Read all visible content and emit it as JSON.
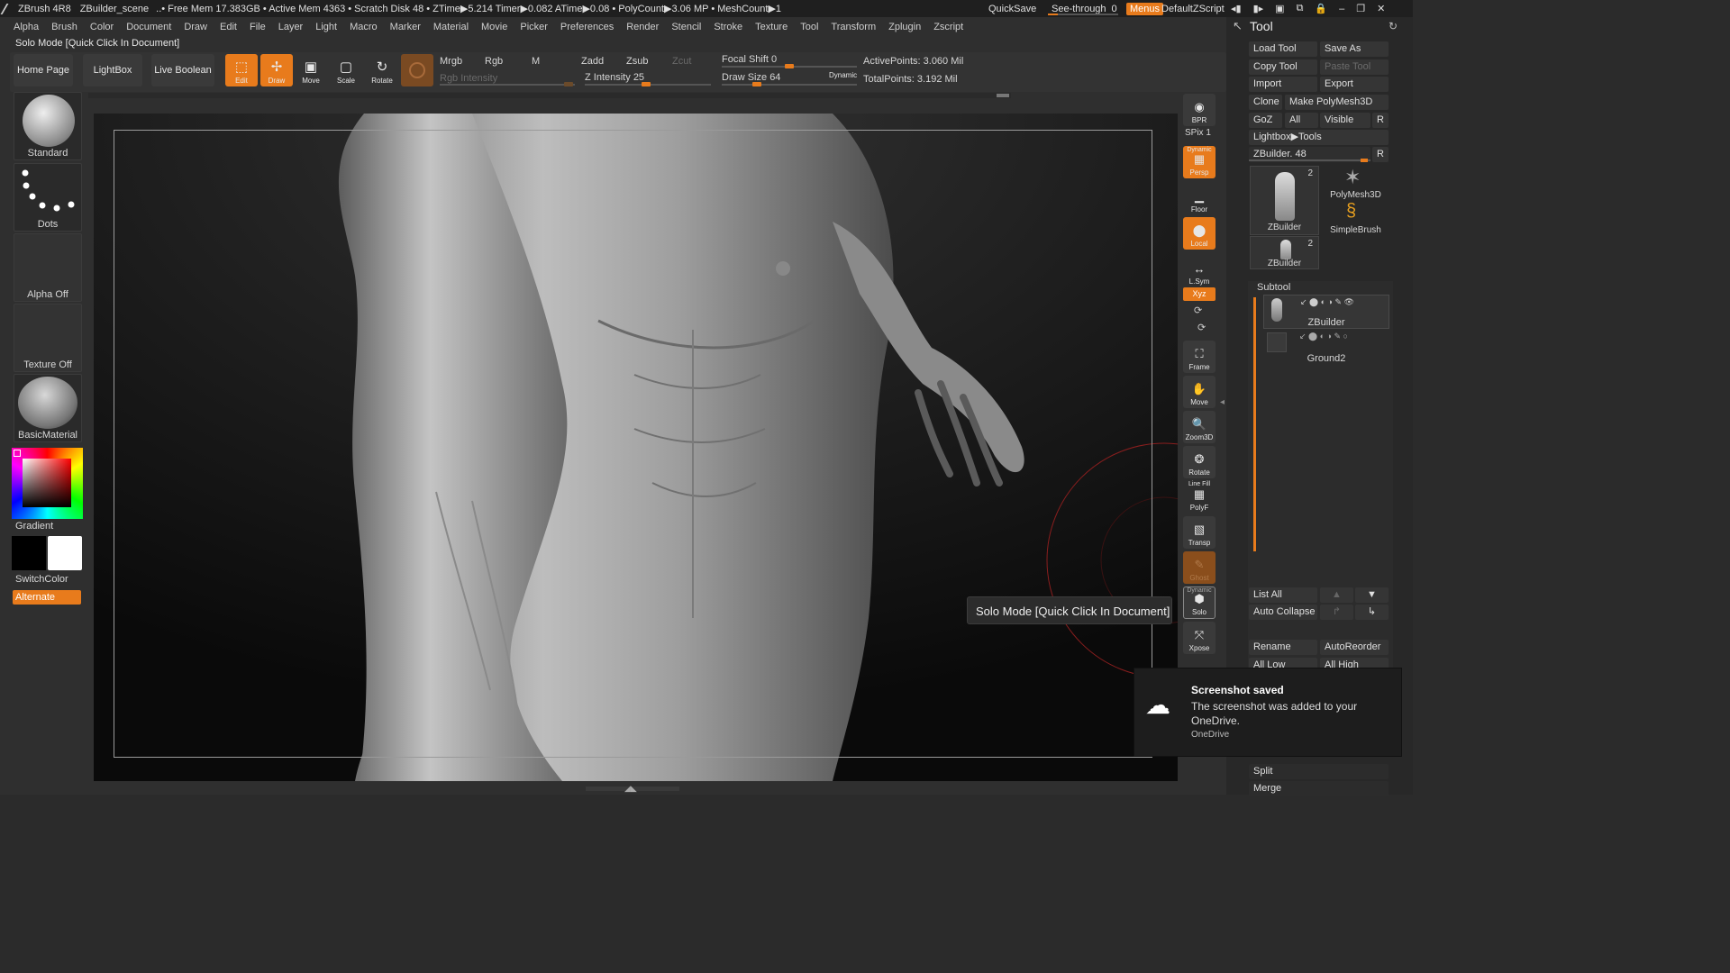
{
  "titlebar": {
    "app": "ZBrush 4R8",
    "scene": "ZBuilder_scene",
    "stats": "..• Free Mem 17.383GB • Active Mem 4363 • Scratch Disk 48 • ZTime▶5.214 Timer▶0.082 ATime▶0.08 • PolyCount▶3.06 MP • MeshCount▶1",
    "quicksave": "QuickSave",
    "seethrough_label": "See-through",
    "seethrough_value": "0",
    "seethrough_level": 0.0,
    "menus": "Menus",
    "script": "DefaultZScript"
  },
  "menubar": [
    "Alpha",
    "Brush",
    "Color",
    "Document",
    "Draw",
    "Edit",
    "File",
    "Layer",
    "Light",
    "Macro",
    "Marker",
    "Material",
    "Movie",
    "Picker",
    "Preferences",
    "Render",
    "Stencil",
    "Stroke",
    "Texture",
    "Tool",
    "Transform",
    "Zplugin",
    "Zscript"
  ],
  "solo_status": "Solo Mode [Quick Click In Document]",
  "toolbar": {
    "home": "Home Page",
    "lightbox": "LightBox",
    "live_boolean": "Live Boolean",
    "edit": "Edit",
    "draw": "Draw",
    "move": "Move",
    "scale": "Scale",
    "rotate": "Rotate",
    "mrgb": "Mrgb",
    "rgb": "Rgb",
    "m": "M",
    "rgb_intensity": "Rgb Intensity",
    "zadd": "Zadd",
    "zsub": "Zsub",
    "zcut": "Zcut",
    "z_intensity_label": "Z Intensity",
    "z_intensity": "25",
    "focal_shift_label": "Focal Shift",
    "focal_shift": "0",
    "draw_size_label": "Draw Size",
    "draw_size": "64",
    "dynamic": "Dynamic",
    "active_points": "ActivePoints: 3.060 Mil",
    "total_points": "TotalPoints: 3.192 Mil"
  },
  "left_shelf": {
    "brush": "Standard",
    "stroke": "Dots",
    "alpha": "Alpha Off",
    "texture": "Texture Off",
    "material": "BasicMaterial",
    "gradient": "Gradient",
    "switchcolor": "SwitchColor",
    "alternate": "Alternate",
    "colors": {
      "accent": "#e87b1c",
      "primary": "#000000",
      "secondary": "#ffffff"
    }
  },
  "right_shelf": {
    "bpr": "BPR",
    "spix": "SPix 1",
    "persp": "Persp",
    "dynamic": "Dynamic",
    "floor": "Floor",
    "local": "Local",
    "lsym": "L.Sym",
    "xyz": "Xyz",
    "frame": "Frame",
    "move": "Move",
    "zoom3d": "Zoom3D",
    "rotate": "Rotate",
    "line_fill": "Line Fill",
    "polyf": "PolyF",
    "transp": "Transp",
    "ghost": "Ghost",
    "solo": "Solo",
    "solo_dynamic": "Dynamic",
    "xpose": "Xpose"
  },
  "tooltip": "Solo Mode [Quick Click In Document]",
  "tool_panel": {
    "title": "Tool",
    "load_tool": "Load Tool",
    "save_as": "Save As",
    "copy_tool": "Copy Tool",
    "paste_tool": "Paste Tool",
    "import": "Import",
    "export": "Export",
    "clone": "Clone",
    "make_polymesh": "Make PolyMesh3D",
    "goz": "GoZ",
    "all": "All",
    "visible": "Visible",
    "r": "R",
    "lightbox_tools": "Lightbox▶Tools",
    "zbuilder_slider": "ZBuilder. 48",
    "thumb_zbuilder": "ZBuilder",
    "thumb_count": "2",
    "thumb_polymesh": "PolyMesh3D",
    "thumb_simplebrush": "SimpleBrush",
    "thumb_zbuilder2": "ZBuilder",
    "thumb_count2": "2",
    "subtool": "Subtool",
    "subtool_items": [
      "ZBuilder",
      "Ground2"
    ],
    "list_all": "List All",
    "auto_collapse": "Auto Collapse",
    "rename": "Rename",
    "autoreorder": "AutoReorder",
    "all_low": "All Low",
    "all_high": "All High",
    "split": "Split",
    "merge": "Merge"
  },
  "toast": {
    "title": "Screenshot saved",
    "body": "The screenshot was added to your OneDrive.",
    "source": "OneDrive"
  }
}
